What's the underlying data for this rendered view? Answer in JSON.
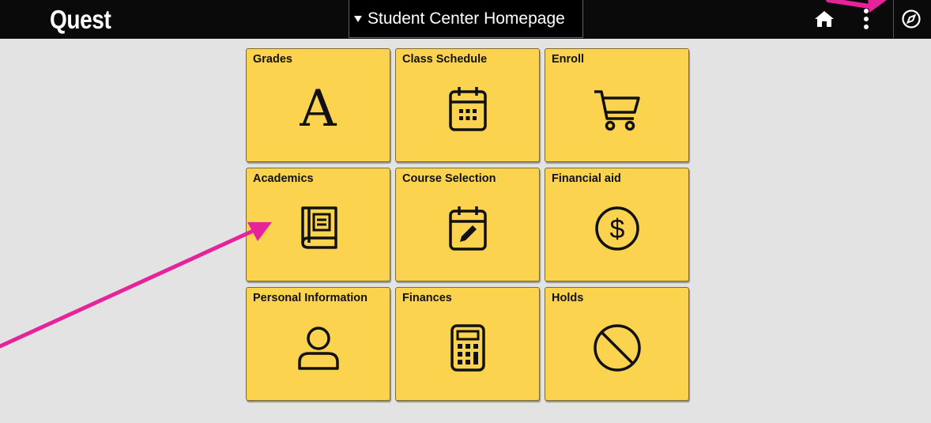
{
  "header": {
    "logo": "Quest",
    "page_selector": "Student Center Homepage",
    "icons": [
      "home-icon",
      "more-vertical-icon",
      "nav-bar-icon"
    ]
  },
  "tiles": [
    {
      "title": "Grades",
      "icon": "letter-a-icon",
      "glyph": "A"
    },
    {
      "title": "Class Schedule",
      "icon": "calendar-icon"
    },
    {
      "title": "Enroll",
      "icon": "shopping-cart-icon"
    },
    {
      "title": "Academics",
      "icon": "book-icon"
    },
    {
      "title": "Course Selection",
      "icon": "calendar-edit-icon"
    },
    {
      "title": "Financial aid",
      "icon": "dollar-circle-icon"
    },
    {
      "title": "Personal Information",
      "icon": "person-icon"
    },
    {
      "title": "Finances",
      "icon": "calculator-icon"
    },
    {
      "title": "Holds",
      "icon": "prohibited-icon"
    }
  ],
  "colors": {
    "header_bg": "#0a0a0a",
    "page_bg": "#e3e3e3",
    "tile_bg": "#fcd34f",
    "annotation_arrow": "#e6239a"
  },
  "annotations": [
    {
      "type": "arrow",
      "points_to": "Academics tile",
      "color": "#e6239a"
    },
    {
      "type": "arrow",
      "points_to": "more-vertical-icon",
      "color": "#e6239a"
    }
  ]
}
